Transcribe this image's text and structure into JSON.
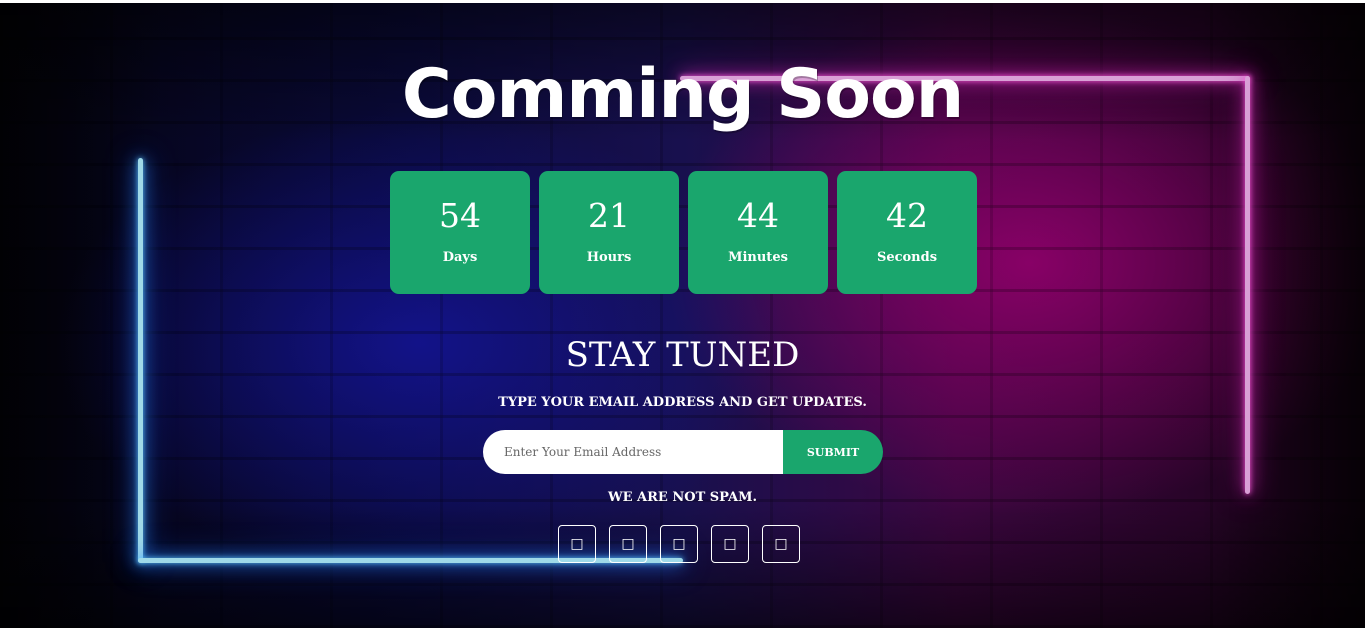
{
  "hero": {
    "title": "Comming Soon"
  },
  "countdown": [
    {
      "value": "54",
      "label": "Days"
    },
    {
      "value": "21",
      "label": "Hours"
    },
    {
      "value": "44",
      "label": "Minutes"
    },
    {
      "value": "42",
      "label": "Seconds"
    }
  ],
  "newsletter": {
    "heading": "STAY TUNED",
    "subheading": "TYPE YOUR EMAIL ADDRESS AND GET UPDATES.",
    "email_placeholder": "Enter Your Email Address",
    "email_value": "",
    "submit_label": "SUBMIT",
    "note": "WE ARE NOT SPAM."
  },
  "socials": [
    {
      "icon": "social-icon-1",
      "glyph": "□"
    },
    {
      "icon": "social-icon-2",
      "glyph": "□"
    },
    {
      "icon": "social-icon-3",
      "glyph": "□"
    },
    {
      "icon": "social-icon-4",
      "glyph": "□"
    },
    {
      "icon": "social-icon-5",
      "glyph": "□"
    }
  ],
  "colors": {
    "accent": "#1aa66d",
    "neon_blue": "#5cc4ff",
    "neon_pink": "#ff5ce0"
  }
}
